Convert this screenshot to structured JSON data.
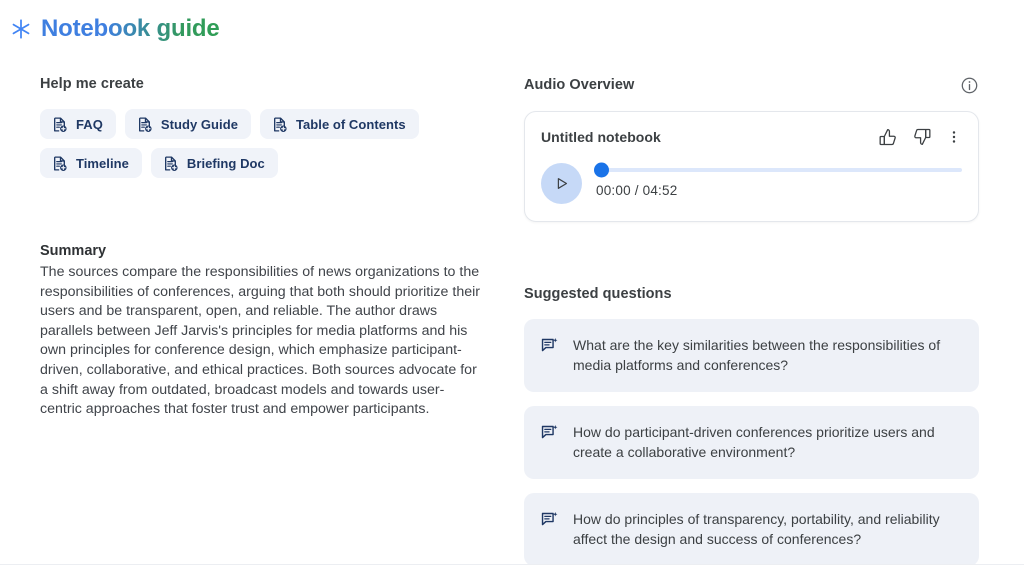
{
  "header": {
    "title": "Notebook guide",
    "icon": "sparkle-icon",
    "gradient_start": "#3f7fe0",
    "gradient_end": "#2e9e54"
  },
  "help_me_create": {
    "label": "Help me create",
    "chips": [
      {
        "label": "FAQ",
        "icon": "document-add-icon"
      },
      {
        "label": "Study Guide",
        "icon": "document-add-icon"
      },
      {
        "label": "Table of Contents",
        "icon": "document-add-icon"
      },
      {
        "label": "Timeline",
        "icon": "document-add-icon"
      },
      {
        "label": "Briefing Doc",
        "icon": "document-add-icon"
      }
    ]
  },
  "summary": {
    "title": "Summary",
    "body": "The sources compare the responsibilities of news organizations to the responsibilities of conferences, arguing that both should prioritize their users and be transparent, open, and reliable. The author draws parallels between Jeff Jarvis's principles for media platforms and his own principles for conference design, which emphasize participant-driven, collaborative, and ethical practices. Both sources advocate for a shift away from outdated, broadcast models and towards user-centric approaches that foster trust and empower participants."
  },
  "audio_overview": {
    "label": "Audio Overview",
    "info_icon": "info-icon",
    "notebook_title": "Untitled notebook",
    "actions": [
      {
        "name": "thumb-up-icon"
      },
      {
        "name": "thumb-down-icon"
      },
      {
        "name": "more-options-icon"
      }
    ],
    "player": {
      "play_icon": "play-icon",
      "current_time": "00:00",
      "total_time": "04:52",
      "time_display": "00:00 / 04:52",
      "progress_percent": 0,
      "accent_color": "#1a73e8",
      "track_color": "#dce7fb",
      "play_button_color": "#c6d9f7"
    }
  },
  "suggested_questions": {
    "label": "Suggested questions",
    "items": [
      {
        "text": "What are the key similarities between the responsibilities of media platforms and conferences?",
        "icon": "question-sparkle-icon"
      },
      {
        "text": "How do participant-driven conferences prioritize users and create a collaborative environment?",
        "icon": "question-sparkle-icon"
      },
      {
        "text": "How do principles of transparency, portability, and reliability affect the design and success of conferences?",
        "icon": "question-sparkle-icon"
      }
    ]
  }
}
